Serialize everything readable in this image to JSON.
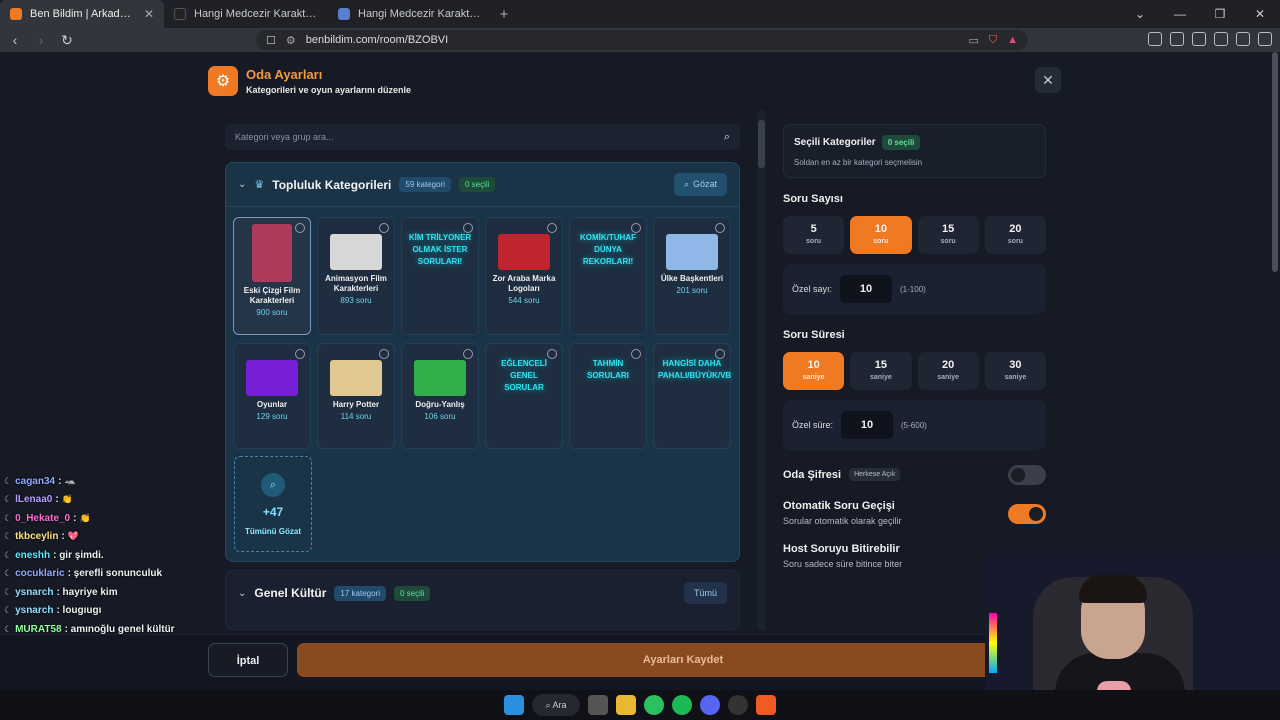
{
  "browser": {
    "tabs": [
      {
        "title": "Ben Bildim | Arkadaşlarınla Online",
        "color": "#f07a24"
      },
      {
        "title": "Hangi Medcezir Karakteriyle Sevgili O",
        "color": "#222222"
      },
      {
        "title": "Hangi Medcezir Karakterisin? - Test",
        "color": "#5b7fd0"
      }
    ],
    "url": "benbildim.com/room/BZOBVI"
  },
  "header": {
    "title": "Oda Ayarları",
    "subtitle": "Kategorileri ve oyun ayarlarını düzenle"
  },
  "search": {
    "placeholder": "Kategori veya grup ara..."
  },
  "community": {
    "title": "Topluluk Kategorileri",
    "count": "59 kategori",
    "selected": "0 seçili",
    "browse": "Gözat",
    "cards": [
      {
        "name": "Eski Çizgi Film Karakterleri",
        "count": "900 soru",
        "img": "#b03a5a"
      },
      {
        "name": "Animasyon Film Karakterleri",
        "count": "893 soru",
        "img": "#d8d8d8"
      },
      {
        "text": "KİM TRİLYONER OLMAK İSTER SORULARI!"
      },
      {
        "name": "Zor Araba Marka Logoları",
        "count": "544 soru",
        "img": "#c0242e"
      },
      {
        "text": "KOMİK/TUHAF DÜNYA REKORLARI!"
      },
      {
        "name": "Ülke Başkentleri",
        "count": "201 soru",
        "img": "#8fb8e8"
      },
      {
        "name": "Oyunlar",
        "count": "129 soru",
        "img": "#7a1fd8"
      },
      {
        "name": "Harry Potter",
        "count": "114 soru",
        "img": "#e0c890"
      },
      {
        "name": "Doğru-Yanlış",
        "count": "106 soru",
        "img": "#2fb04a"
      },
      {
        "text": "EĞLENCELİ GENEL SORULAR"
      },
      {
        "text": "TAHMİN SORULARI"
      },
      {
        "text": "HANGİSİ DAHA PAHALI/BÜYÜK/VB"
      }
    ],
    "more_count": "+47",
    "more_label": "Tümünü Gözat"
  },
  "general": {
    "title": "Genel Kültür",
    "count": "17 kategori",
    "selected": "0 seçili",
    "all": "Tümü"
  },
  "selected_panel": {
    "title": "Seçili Kategoriler",
    "badge": "0 seçili",
    "hint": "Soldan en az bir kategori seçmelisin"
  },
  "question_count": {
    "title": "Soru Sayısı",
    "options": [
      {
        "value": "5",
        "unit": "soru"
      },
      {
        "value": "10",
        "unit": "soru"
      },
      {
        "value": "15",
        "unit": "soru"
      },
      {
        "value": "20",
        "unit": "soru"
      }
    ],
    "selected_index": 1,
    "custom_label": "Özel sayı:",
    "custom_value": "10",
    "custom_range": "(1-100)"
  },
  "question_time": {
    "title": "Soru Süresi",
    "options": [
      {
        "value": "10",
        "unit": "saniye"
      },
      {
        "value": "15",
        "unit": "saniye"
      },
      {
        "value": "20",
        "unit": "saniye"
      },
      {
        "value": "30",
        "unit": "saniye"
      }
    ],
    "selected_index": 0,
    "custom_label": "Özel süre:",
    "custom_value": "10",
    "custom_range": "(5-600)"
  },
  "room_password": {
    "label": "Oda Şifresi",
    "badge": "Herkese Açık",
    "on": false
  },
  "auto_next": {
    "label": "Otomatik Soru Geçişi",
    "sub": "Sorular otomatik olarak geçilir",
    "on": true
  },
  "host_end": {
    "label": "Host Soruyu Bitirebilir",
    "sub": "Soru sadece süre bitince biter"
  },
  "footer": {
    "cancel": "İptal",
    "save": "Ayarları Kaydet"
  },
  "chat": [
    {
      "user": "cagan34",
      "msg": ":",
      "color": "#8fa8ff",
      "emote": "🦡"
    },
    {
      "user": "lLenaa0",
      "msg": ":",
      "color": "#b8a0ff",
      "emote": "👏"
    },
    {
      "user": "0_Hekate_0",
      "msg": ":",
      "color": "#ff6ad0",
      "emote": "👏"
    },
    {
      "user": "tkbceylin",
      "msg": ":",
      "color": "#ffe07a",
      "emote": "💖"
    },
    {
      "user": "eneshh",
      "msg": ": gir şimdi.",
      "color": "#5ee8ff",
      "emote": ""
    },
    {
      "user": "cocuklaric",
      "msg": ": şerefli sonunculuk",
      "color": "#8fa8ff",
      "emote": ""
    },
    {
      "user": "ysnarch",
      "msg": ": hayriye kim",
      "color": "#8fe0ff",
      "emote": ""
    },
    {
      "user": "ysnarch",
      "msg": ": lougıugı",
      "color": "#8fe0ff",
      "emote": ""
    },
    {
      "user": "MURAT58",
      "msg": ": amınoğlu genel kültür",
      "color": "#8fff9a",
      "emote": ""
    }
  ],
  "taskbar": {
    "search": "Ara"
  }
}
